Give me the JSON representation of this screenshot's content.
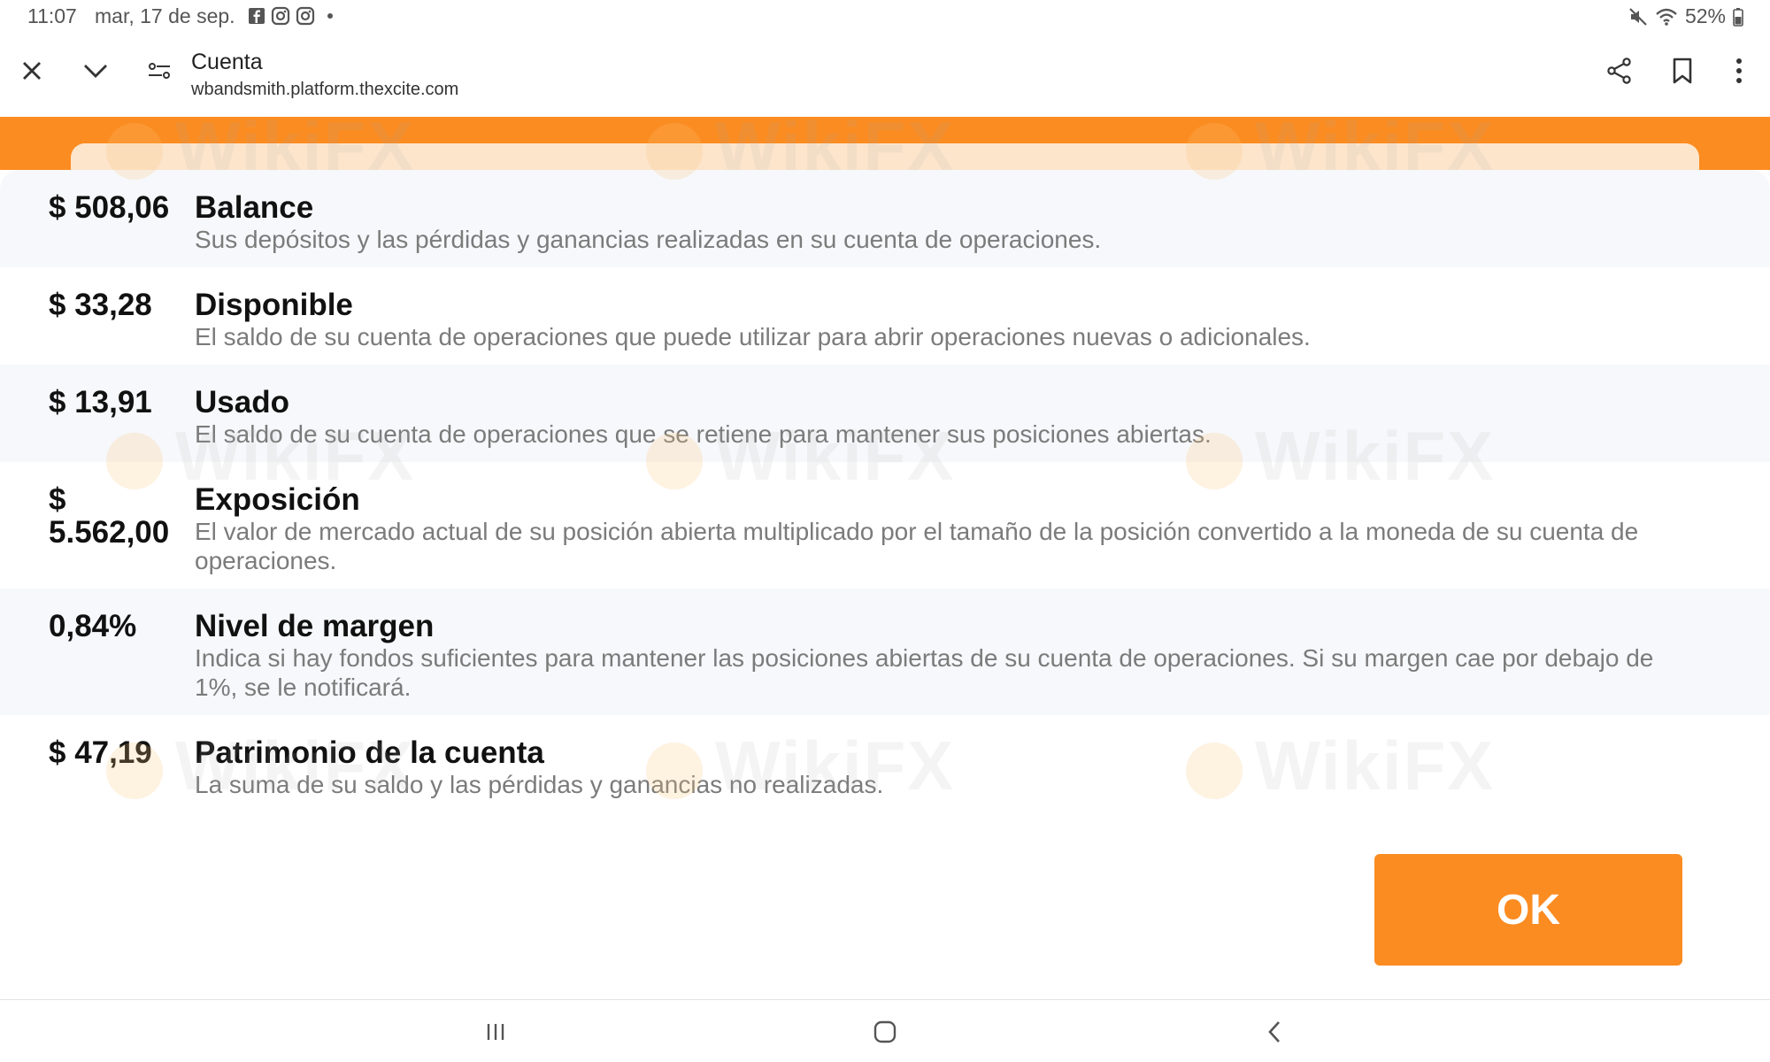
{
  "status_bar": {
    "time": "11:07",
    "date": "mar, 17 de sep.",
    "battery": "52%",
    "left_icons": [
      "facebook-icon",
      "instagram-icon",
      "instagram-icon"
    ],
    "right_icons": [
      "mute-icon",
      "wifi-icon",
      "battery-icon"
    ]
  },
  "browser": {
    "title": "Cuenta",
    "url": "wbandsmith.platform.thexcite.com"
  },
  "account_rows": [
    {
      "value": "$ 508,06",
      "title": "Balance",
      "description": "Sus depósitos y las pérdidas y ganancias realizadas en su cuenta de operaciones."
    },
    {
      "value": "$ 33,28",
      "title": "Disponible",
      "description": "El saldo de su cuenta de operaciones que puede utilizar para abrir operaciones nuevas o adicionales."
    },
    {
      "value": "$ 13,91",
      "title": "Usado",
      "description": "El saldo de su cuenta de operaciones que se retiene para mantener sus posiciones abiertas."
    },
    {
      "value": "$ 5.562,00",
      "title": "Exposición",
      "description": "El valor de mercado actual de su posición abierta multiplicado por el tamaño de la posición convertido a la moneda de su cuenta de operaciones."
    },
    {
      "value": "0,84%",
      "title": "Nivel de margen",
      "description": "Indica si hay fondos suficientes para mantener las posiciones abiertas de su cuenta de operaciones. Si su margen cae por debajo de 1%, se le notificará."
    },
    {
      "value": "$ 47,19",
      "title": "Patrimonio de la cuenta",
      "description": "La suma de su saldo y las pérdidas y ganancias no realizadas."
    }
  ],
  "ok_label": "OK",
  "watermark_text": "WikiFX",
  "colors": {
    "accent": "#fb8c21",
    "row_shade": "#f7f8fb",
    "description_text": "#7b7b7b"
  }
}
